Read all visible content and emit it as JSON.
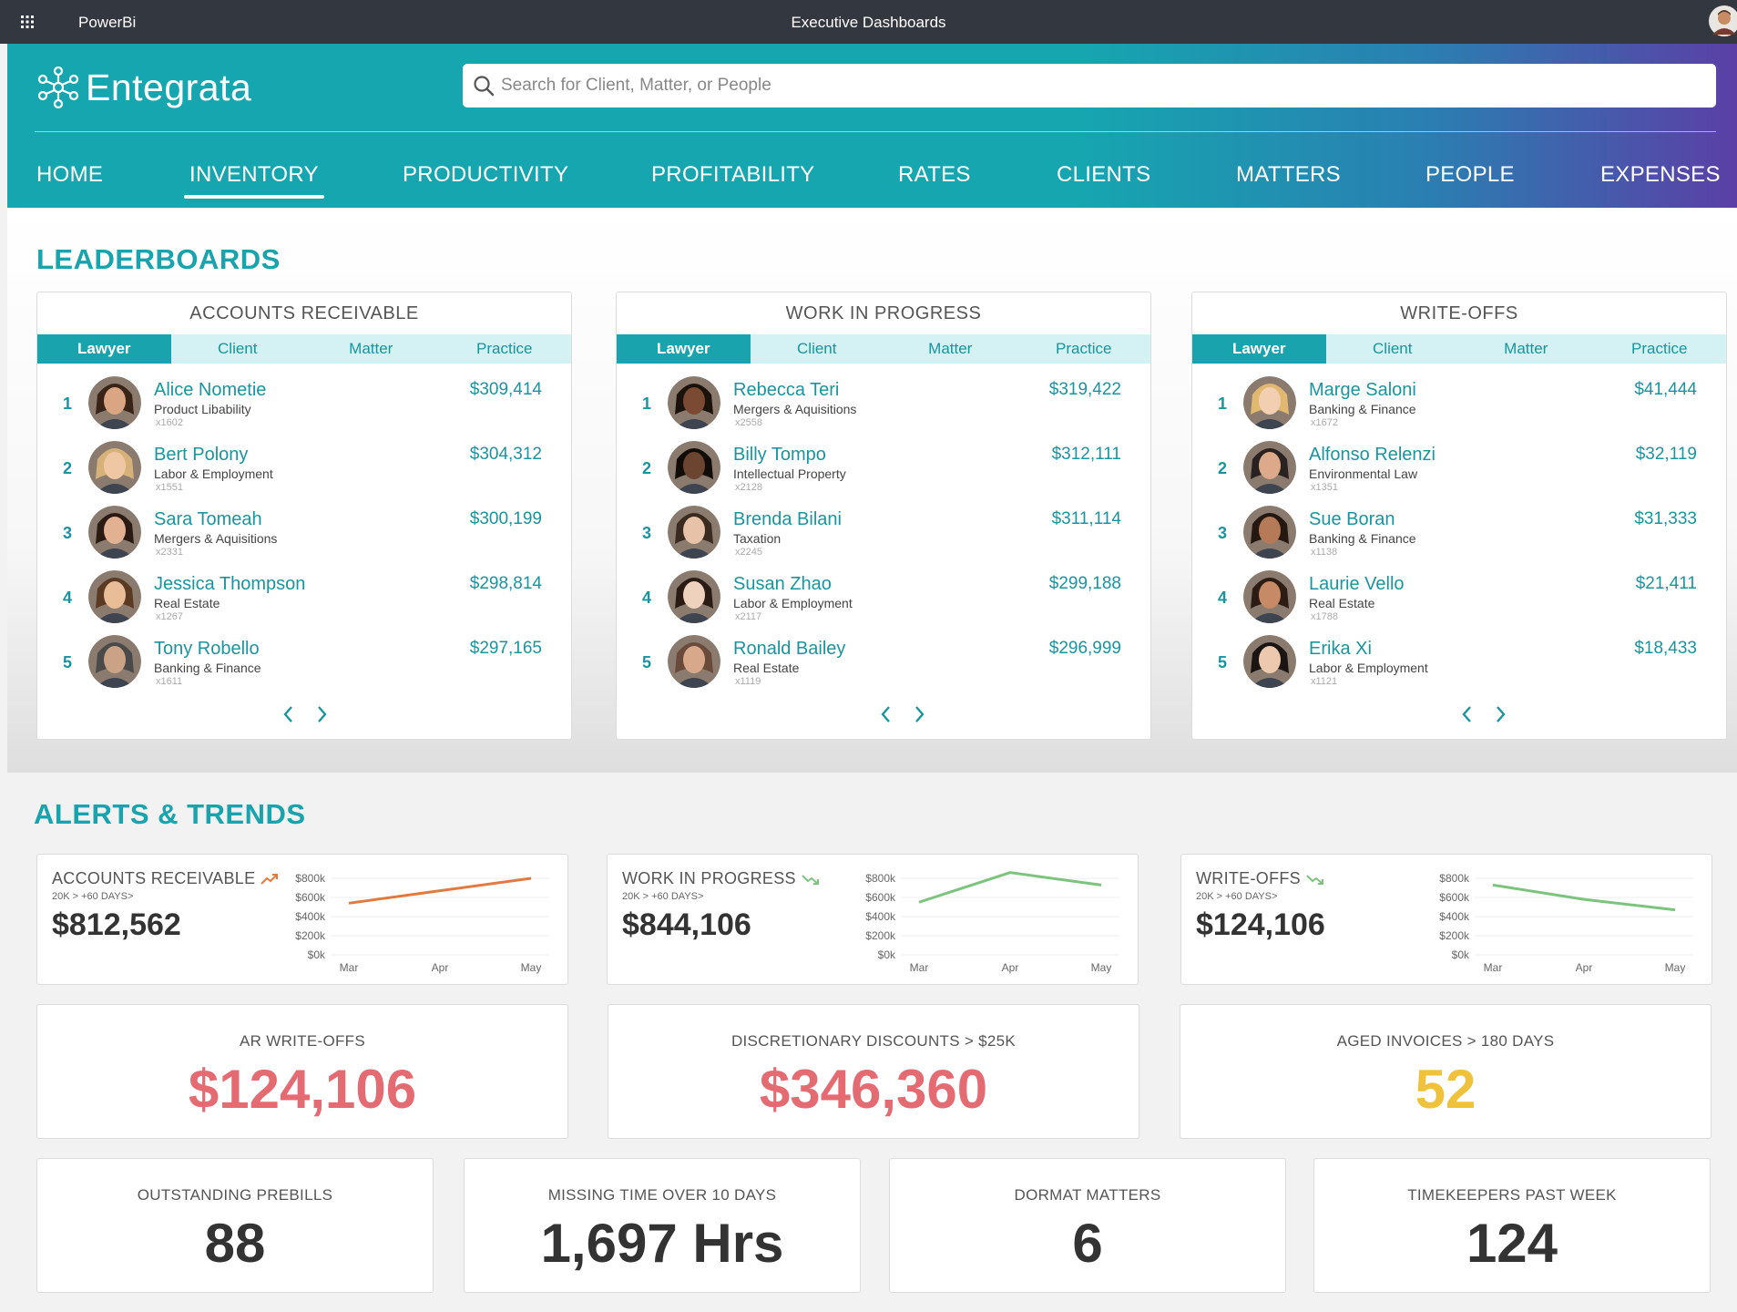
{
  "topbar": {
    "app_name": "PowerBi",
    "title": "Executive Dashboards"
  },
  "brand": {
    "name": "Entegrata"
  },
  "search": {
    "placeholder": "Search for Client, Matter, or People"
  },
  "nav": {
    "items": [
      "HOME",
      "INVENTORY",
      "PRODUCTIVITY",
      "PROFITABILITY",
      "RATES",
      "CLIENTS",
      "MATTERS",
      "PEOPLE",
      "EXPENSES"
    ],
    "active": "INVENTORY"
  },
  "leaderboards": {
    "title": "LEADERBOARDS",
    "tabs": [
      "Lawyer",
      "Client",
      "Matter",
      "Practice"
    ],
    "cards": [
      {
        "title": "ACCOUNTS RECEIVABLE",
        "rows": [
          {
            "rank": "1",
            "name": "Alice Nometie",
            "practice": "Product Libability",
            "ext": "x1602",
            "amount": "$309,414"
          },
          {
            "rank": "2",
            "name": "Bert Polony",
            "practice": "Labor & Employment",
            "ext": "x1551",
            "amount": "$304,312"
          },
          {
            "rank": "3",
            "name": "Sara Tomeah",
            "practice": "Mergers & Aquisitions",
            "ext": "x2331",
            "amount": "$300,199"
          },
          {
            "rank": "4",
            "name": "Jessica Thompson",
            "practice": "Real Estate",
            "ext": "x1267",
            "amount": "$298,814"
          },
          {
            "rank": "5",
            "name": "Tony Robello",
            "practice": "Banking & Finance",
            "ext": "x1611",
            "amount": "$297,165"
          }
        ]
      },
      {
        "title": "WORK IN PROGRESS",
        "rows": [
          {
            "rank": "1",
            "name": "Rebecca Teri",
            "practice": "Mergers & Aquisitions",
            "ext": "x2558",
            "amount": "$319,422"
          },
          {
            "rank": "2",
            "name": "Billy Tompo",
            "practice": "Intellectual Property",
            "ext": "x2128",
            "amount": "$312,111"
          },
          {
            "rank": "3",
            "name": "Brenda Bilani",
            "practice": "Taxation",
            "ext": "x2245",
            "amount": "$311,114"
          },
          {
            "rank": "4",
            "name": "Susan Zhao",
            "practice": "Labor & Employment",
            "ext": "x2117",
            "amount": "$299,188"
          },
          {
            "rank": "5",
            "name": "Ronald Bailey",
            "practice": "Real Estate",
            "ext": "x1119",
            "amount": "$296,999"
          }
        ]
      },
      {
        "title": "WRITE-OFFS",
        "rows": [
          {
            "rank": "1",
            "name": "Marge Saloni",
            "practice": "Banking & Finance",
            "ext": "x1672",
            "amount": "$41,444"
          },
          {
            "rank": "2",
            "name": "Alfonso Relenzi",
            "practice": "Environmental Law",
            "ext": "x1351",
            "amount": "$32,119"
          },
          {
            "rank": "3",
            "name": "Sue Boran",
            "practice": "Banking & Finance",
            "ext": "x1138",
            "amount": "$31,333"
          },
          {
            "rank": "4",
            "name": "Laurie Vello",
            "practice": "Real Estate",
            "ext": "x1788",
            "amount": "$21,411"
          },
          {
            "rank": "5",
            "name": "Erika Xi",
            "practice": "Labor & Employment",
            "ext": "x1121",
            "amount": "$18,433"
          }
        ]
      }
    ]
  },
  "alerts": {
    "title": "ALERTS & TRENDS",
    "trends": [
      {
        "title": "ACCOUNTS RECEIVABLE",
        "subtitle": "20K > +60 DAYS>",
        "value": "$812,562",
        "direction": "up",
        "color": "#e07a3f"
      },
      {
        "title": "WORK IN PROGRESS",
        "subtitle": "20K > +60 DAYS>",
        "value": "$844,106",
        "direction": "down",
        "color": "#7cc47e"
      },
      {
        "title": "WRITE-OFFS",
        "subtitle": "20K > +60 DAYS>",
        "value": "$124,106",
        "direction": "down",
        "color": "#7cc47e"
      }
    ],
    "kpis_row1": [
      {
        "label": "AR WRITE-OFFS",
        "value": "$124,106",
        "color": "#e56b73"
      },
      {
        "label": "DISCRETIONARY DISCOUNTS > $25K",
        "value": "$346,360",
        "color": "#e56b73"
      },
      {
        "label": "AGED INVOICES > 180 DAYS",
        "value": "52",
        "color": "#f0c23b"
      }
    ],
    "kpis_row2": [
      {
        "label": "OUTSTANDING PREBILLS",
        "value": "88"
      },
      {
        "label": "MISSING TIME OVER 10 DAYS",
        "value": "1,697 Hrs"
      },
      {
        "label": "DORMAT MATTERS",
        "value": "6"
      },
      {
        "label": "TIMEKEEPERS PAST WEEK",
        "value": "124"
      }
    ]
  },
  "chart_data": [
    {
      "type": "line",
      "categories": [
        "Mar",
        "Apr",
        "May"
      ],
      "yticks": [
        "$800k",
        "$600k",
        "$400k",
        "$200k",
        "$0k"
      ],
      "ylim": [
        0,
        800000
      ],
      "series": [
        {
          "values": [
            540000,
            670000,
            800000
          ],
          "color": "#e07a3f"
        }
      ]
    },
    {
      "type": "line",
      "categories": [
        "Mar",
        "Apr",
        "May"
      ],
      "yticks": [
        "$800k",
        "$600k",
        "$400k",
        "$200k",
        "$0k"
      ],
      "ylim": [
        0,
        800000
      ],
      "series": [
        {
          "values": [
            550000,
            860000,
            730000
          ],
          "color": "#7cc47e"
        }
      ]
    },
    {
      "type": "line",
      "categories": [
        "Mar",
        "Apr",
        "May"
      ],
      "yticks": [
        "$800k",
        "$600k",
        "$400k",
        "$200k",
        "$0k"
      ],
      "ylim": [
        0,
        800000
      ],
      "series": [
        {
          "values": [
            730000,
            580000,
            470000
          ],
          "color": "#7cc47e"
        }
      ]
    }
  ]
}
